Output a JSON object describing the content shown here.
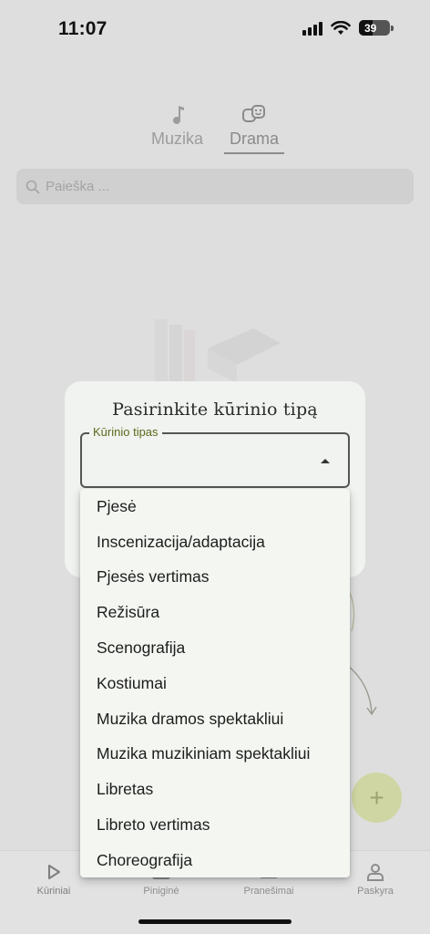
{
  "status_bar": {
    "time": "11:07",
    "battery": "39"
  },
  "tabs": [
    {
      "label": "Muzika",
      "icon": "music-note-icon"
    },
    {
      "label": "Drama",
      "icon": "theater-masks-icon",
      "active": true
    }
  ],
  "search": {
    "placeholder": "Paieška ..."
  },
  "dialog": {
    "title": "Pasirinkite kūrinio tipą",
    "field_label": "Kūrinio tipas",
    "value": ""
  },
  "dropdown": {
    "options": [
      "Pjesė",
      "Inscenizacija/adaptacija",
      "Pjesės vertimas",
      "Režisūra",
      "Scenografija",
      "Kostiumai",
      "Muzika dramos spektakliui",
      "Muzika muzikiniam spektakliui",
      "Libretas",
      "Libreto vertimas",
      "Choreografija"
    ]
  },
  "fab": {
    "label": "+"
  },
  "bottom_nav": [
    {
      "label": "Kūriniai",
      "icon": "play-icon"
    },
    {
      "label": "Piniginė",
      "icon": "wallet-icon"
    },
    {
      "label": "Pranešimai",
      "icon": "bell-icon"
    },
    {
      "label": "Paskyra",
      "icon": "person-icon"
    }
  ],
  "colors": {
    "accent": "#5a6b1e",
    "fab": "#cfd6a3",
    "dialog_bg": "#f0f3ef"
  }
}
